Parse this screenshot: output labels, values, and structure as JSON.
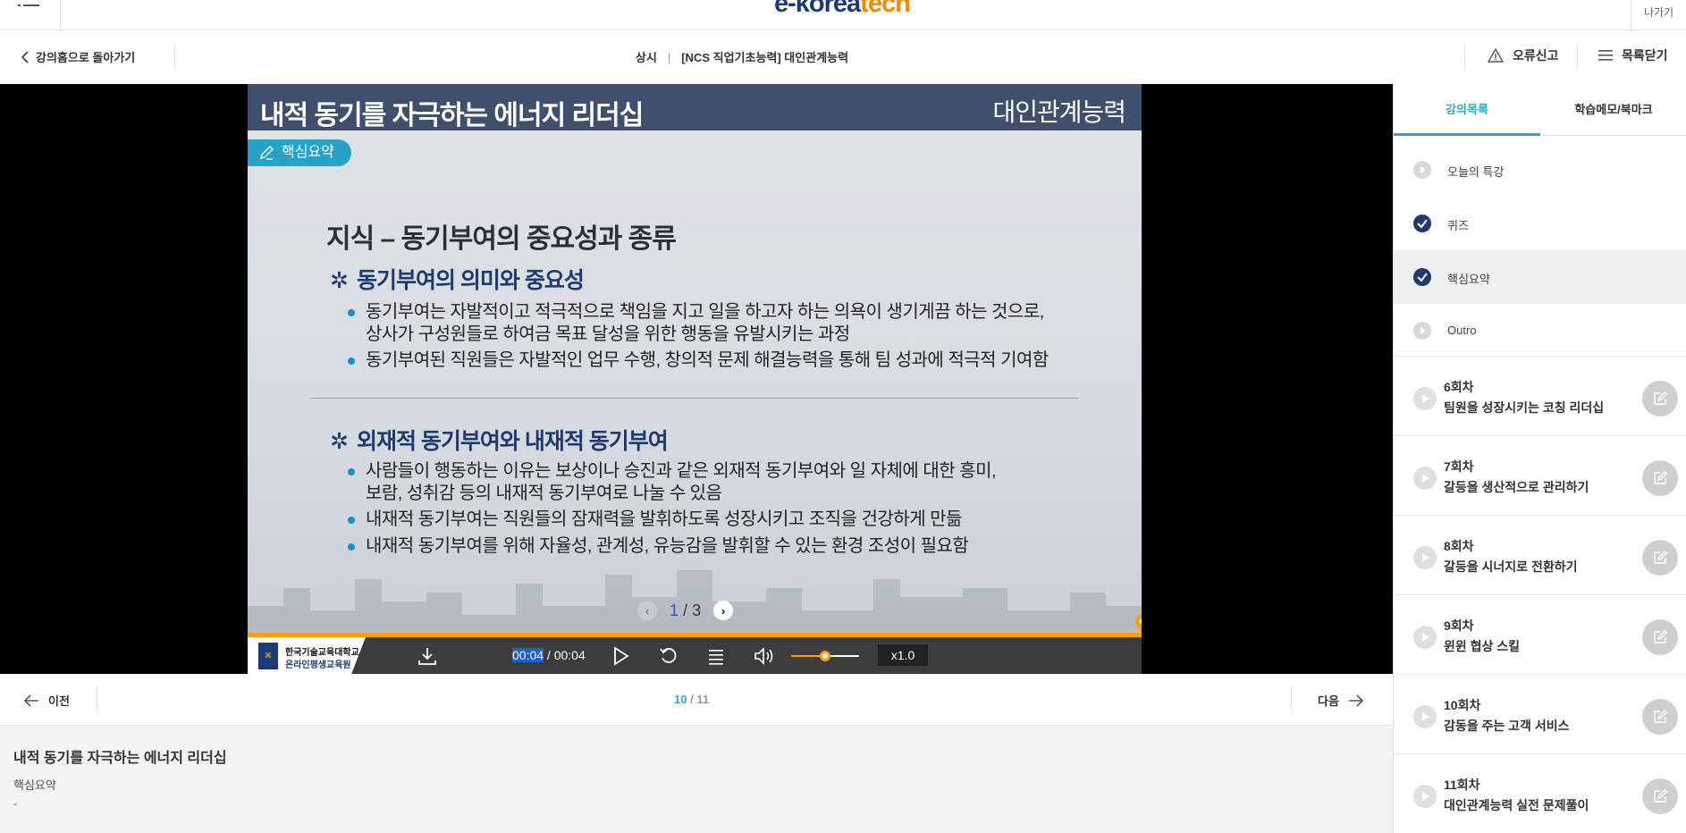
{
  "topbar": {
    "logo_main": "e-korea",
    "logo_accent": "tech",
    "exit_label": "나가기"
  },
  "subbar": {
    "back_label": "강의홈으로 돌아가기",
    "type": "상시",
    "course": "[NCS 직업기초능력] 대인관계능력",
    "report_label": "오류신고",
    "close_list_label": "목록닫기"
  },
  "slide": {
    "title": "내적 동기를 자극하는 에너지 리더십",
    "category": "대인관계능력",
    "badge": "핵심요약",
    "heading": "지식 – 동기부여의 중요성과 종류",
    "section1": {
      "title": "동기부여의 의미와 중요성",
      "bullets": [
        "동기부여는 자발적이고 적극적으로 책임을 지고 일을 하고자 하는 의욕이 생기게끔 하는 것으로,",
        "상사가 구성원들로 하여금 목표 달성을 위한 행동을 유발시키는 과정",
        "동기부여된 직원들은 자발적인 업무 수행, 창의적 문제 해결능력을 통해 팀 성과에 적극적 기여함"
      ]
    },
    "section2": {
      "title": "외재적 동기부여와 내재적 동기부여",
      "bullets": [
        "사람들이 행동하는 이유는 보상이나 승진과 같은 외재적 동기부여와 일 자체에 대한 흥미,",
        "보람, 성취감 등의 내재적 동기부여로 나눌 수 있음",
        "내재적 동기부여는 직원들의 잠재력을 발휘하도록 성장시키고 조직을 건강하게 만듦",
        "내재적 동기부여를 위해 자율성, 관계성, 유능감을 발휘할 수 있는 환경 조성이 필요함"
      ]
    },
    "page_current": "1",
    "page_sep": "/",
    "page_total": "3"
  },
  "controls": {
    "org_line1": "한국기술교육대학교",
    "org_line2": "온라인평생교육원",
    "time_current": "00:04",
    "time_sep": " / ",
    "time_total": "00:04",
    "speed": "x1.0",
    "volume_fraction": 0.5,
    "progress_fraction": 1.0
  },
  "nav": {
    "prev_label": "이전",
    "next_label": "다음",
    "page_current": "10",
    "page_sep": " / ",
    "page_total": "11"
  },
  "info": {
    "title": "내적 동기를 자극하는 에너지 리더십",
    "subtitle": "핵심요약",
    "dash": "-"
  },
  "sidebar": {
    "tab1": "강의목록",
    "tab2": "학습메모/북마크",
    "subitems": [
      {
        "label": "오늘의 특강",
        "state": "play"
      },
      {
        "label": "퀴즈",
        "state": "done"
      },
      {
        "label": "핵심요약",
        "state": "done"
      },
      {
        "label": "Outro",
        "state": "play"
      }
    ],
    "episodes": [
      {
        "num": "6회차",
        "name": "팀원을 성장시키는 코칭 리더십"
      },
      {
        "num": "7회차",
        "name": "갈등을 생산적으로 관리하기"
      },
      {
        "num": "8회차",
        "name": "갈등을 시너지로 전환하기"
      },
      {
        "num": "9회차",
        "name": "윈윈 협상 스킬"
      },
      {
        "num": "10회차",
        "name": "감동을 주는 고객 서비스"
      },
      {
        "num": "11회차",
        "name": "대인관계능력 실전 문제풀이"
      }
    ]
  },
  "colors": {
    "accent": "#2aa9c4",
    "progress": "#f5a010",
    "slide_header": "#414f6e",
    "check": "#1e3a6e"
  }
}
